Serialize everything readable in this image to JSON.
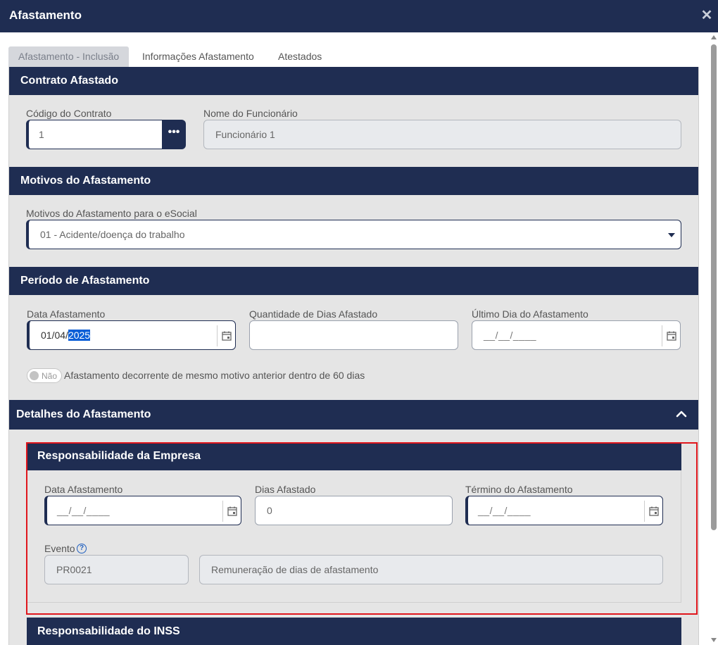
{
  "window": {
    "title": "Afastamento",
    "close_icon": "close-icon"
  },
  "tabs": [
    {
      "label": "Afastamento - Inclusão",
      "active": true
    },
    {
      "label": "Informações Afastamento",
      "active": false
    },
    {
      "label": "Atestados",
      "active": false
    }
  ],
  "contrato": {
    "header": "Contrato Afastado",
    "codigo_label": "Código do Contrato",
    "codigo_value": "1",
    "lookup_label": "•••",
    "nome_label": "Nome do Funcionário",
    "nome_value": "Funcionário 1"
  },
  "motivos": {
    "header": "Motivos do Afastamento",
    "select_label": "Motivos do Afastamento para o eSocial",
    "select_value": "01 - Acidente/doença do trabalho"
  },
  "periodo": {
    "header": "Período de Afastamento",
    "data_label": "Data Afastamento",
    "data_value_prefix": "01/04/",
    "data_value_selected": "2025",
    "qtd_label": "Quantidade de Dias Afastado",
    "qtd_value": "",
    "ultimo_label": "Último Dia do Afastamento",
    "ultimo_mask": "__/__/____",
    "toggle_label": "Não",
    "toggle_on": false,
    "toggle_text": "Afastamento decorrente de mesmo motivo anterior dentro de 60 dias"
  },
  "detalhes": {
    "header": "Detalhes do Afastamento",
    "expanded": true
  },
  "empresa": {
    "header": "Responsabilidade da Empresa",
    "data_label": "Data Afastamento",
    "data_mask": "__/__/____",
    "dias_label": "Dias Afastado",
    "dias_value": "0",
    "termino_label": "Término do Afastamento",
    "termino_mask": "__/__/____",
    "evento_label": "Evento",
    "evento_code": "PR0021",
    "evento_desc": "Remuneração de dias de afastamento",
    "help_icon": "question-circle-icon"
  },
  "inss": {
    "header": "Responsabilidade do INSS"
  },
  "colors": {
    "header_bg": "#1f2d52",
    "highlight": "#e0161c",
    "selection": "#0a5ed7"
  }
}
